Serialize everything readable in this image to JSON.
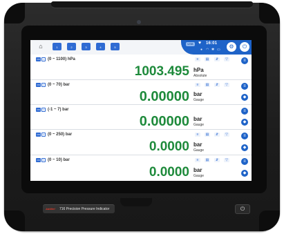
{
  "status_bar": {
    "home_icon": "home-icon",
    "channel_buttons": [
      "1",
      "2",
      "3",
      "4",
      "5"
    ],
    "usb_badge": "USB",
    "time": "16:01",
    "settings_icon": "gear-icon",
    "power_icon": "power-icon",
    "accent_color": "#1e63c8"
  },
  "channels": [
    {
      "on": "ON",
      "ch": "1",
      "range": "(0 ~ 1100) hPa",
      "value": "1003.495",
      "unit": "hPa",
      "mode": "Absolute"
    },
    {
      "on": "ON",
      "ch": "2",
      "range": "(0 ~ 70) bar",
      "value": "0.00000",
      "unit": "bar",
      "mode": "Gauge"
    },
    {
      "on": "ON",
      "ch": "3",
      "range": "(-1 ~ 7) bar",
      "value": "0.00000",
      "unit": "bar",
      "mode": "Gauge"
    },
    {
      "on": "ON",
      "ch": "4",
      "range": "(0 ~ 250) bar",
      "value": "0.0000",
      "unit": "bar",
      "mode": "Gauge"
    },
    {
      "on": "ON",
      "ch": "5",
      "range": "(0 ~ 10) bar",
      "value": "0.0000",
      "unit": "bar",
      "mode": "Gauge"
    }
  ],
  "row_tools": [
    "zero-icon",
    "hold-icon",
    "peak-icon",
    "filter-icon"
  ],
  "value_color": "#1e8a3b",
  "device": {
    "brand": "Additel",
    "product_label": "716 Precision Pressure Indicator",
    "power_button_icon": "power-icon"
  }
}
